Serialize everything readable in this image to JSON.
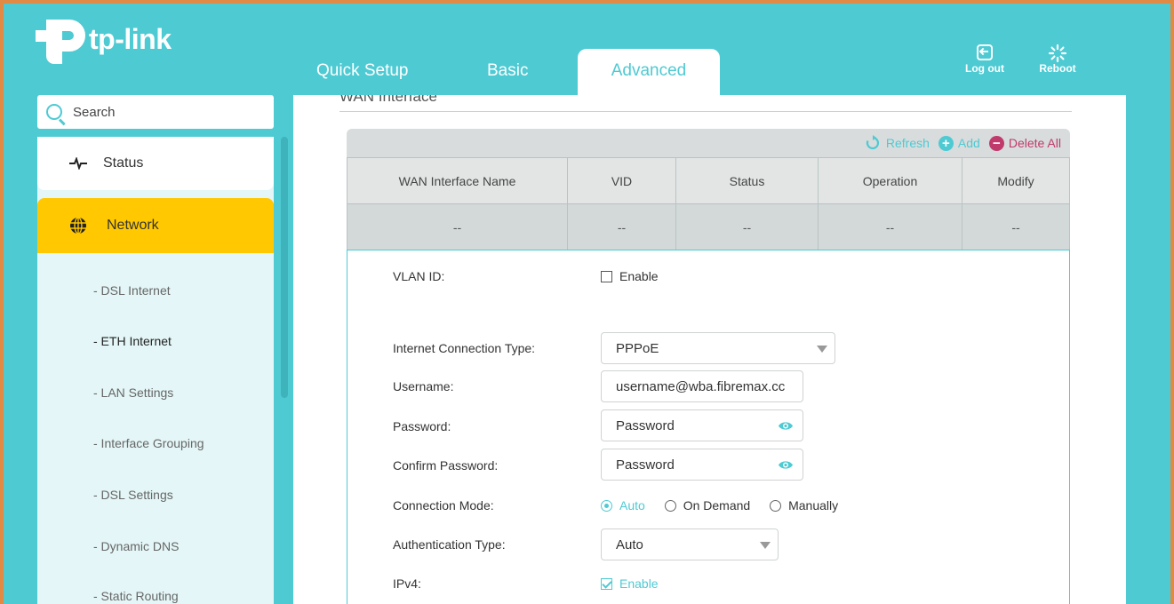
{
  "brand": {
    "name": "tp-link"
  },
  "tabs": [
    {
      "label": "Quick Setup"
    },
    {
      "label": "Basic"
    },
    {
      "label": "Advanced"
    }
  ],
  "actions": {
    "logout": "Log out",
    "reboot": "Reboot"
  },
  "search": {
    "placeholder": "Search"
  },
  "sidebar": {
    "status": "Status",
    "network": "Network",
    "subitems": [
      "- DSL Internet",
      "- ETH Internet",
      "- LAN Settings",
      "- Interface Grouping",
      "- DSL Settings",
      "- Dynamic DNS",
      "- Static Routing"
    ]
  },
  "main": {
    "section_title": "WAN Interface",
    "toolbar": {
      "refresh": "Refresh",
      "add": "Add",
      "delete_all": "Delete All"
    },
    "table": {
      "headers": [
        "WAN Interface Name",
        "VID",
        "Status",
        "Operation",
        "Modify"
      ],
      "row": [
        "--",
        "--",
        "--",
        "--",
        "--"
      ]
    },
    "form": {
      "vlan_label": "VLAN ID:",
      "vlan_enable": "Enable",
      "conn_type_label": "Internet Connection Type:",
      "conn_type_value": "PPPoE",
      "username_label": "Username:",
      "username_value": "username@wba.fibremax.cc",
      "password_label": "Password:",
      "password_placeholder": "Password",
      "confirm_label": "Confirm Password:",
      "confirm_placeholder": "Password",
      "mode_label": "Connection Mode:",
      "mode_options": [
        "Auto",
        "On Demand",
        "Manually"
      ],
      "auth_label": "Authentication Type:",
      "auth_value": "Auto",
      "ipv4_label": "IPv4:",
      "ipv4_enable": "Enable"
    }
  },
  "colors": {
    "accent": "#4ecad3",
    "network_highlight": "#ffc800",
    "danger": "#c03a6b",
    "frame": "#e08a45"
  }
}
